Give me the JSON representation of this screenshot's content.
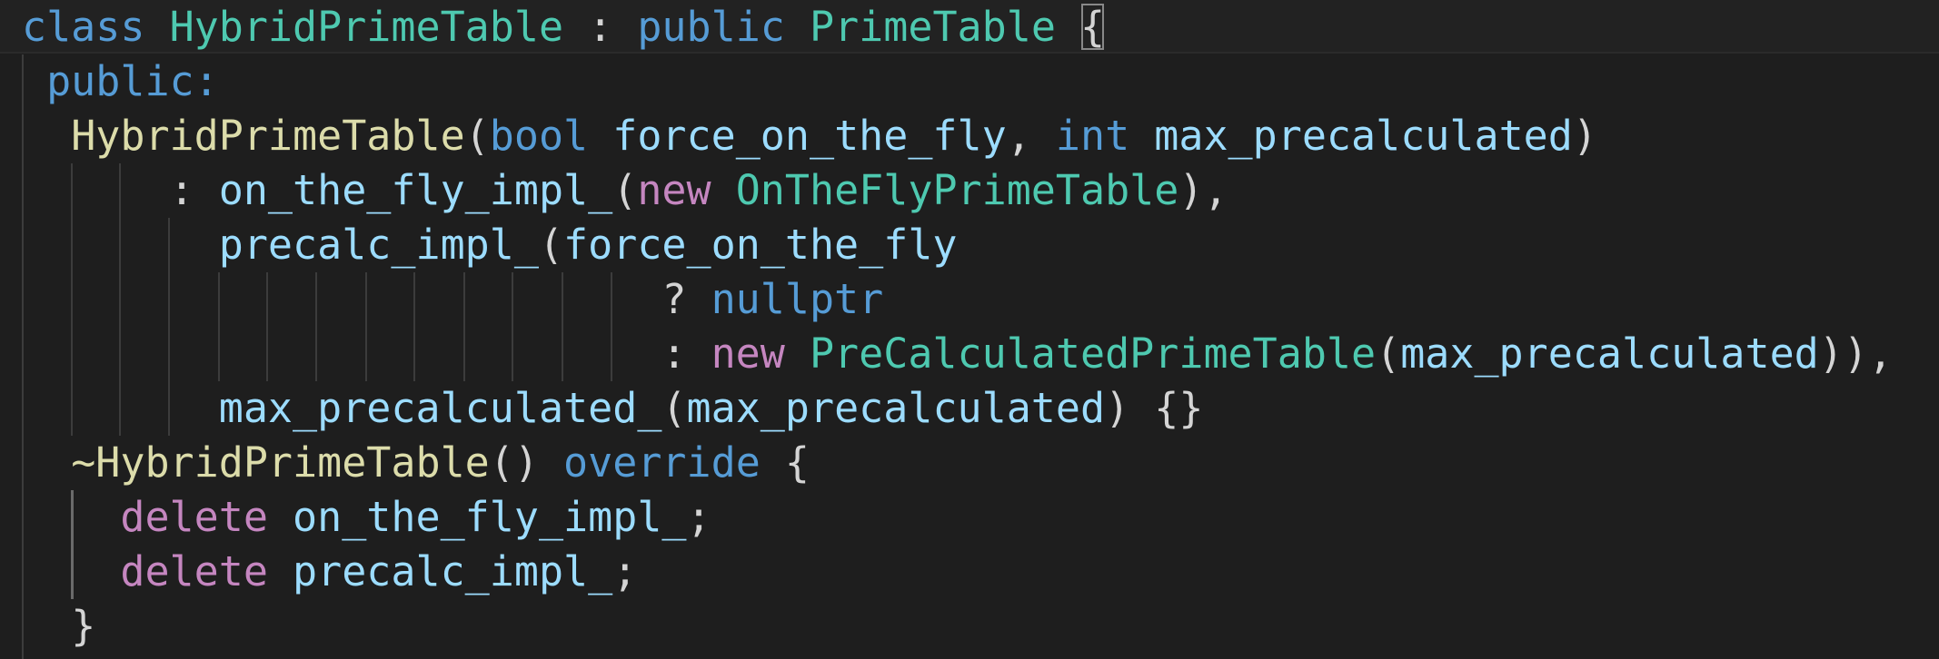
{
  "editor": {
    "language": "cpp",
    "theme_colors": {
      "background": "#1e1e1e",
      "keyword": "#569cd6",
      "type": "#4ec9b0",
      "function": "#dcdcaa",
      "variable": "#9cdcfe",
      "control_keyword": "#c586c0",
      "punctuation": "#d4d4d4"
    },
    "lines": [
      {
        "tokens": [
          {
            "text": "class",
            "kind": "keyword"
          },
          {
            "text": " ",
            "kind": "plain"
          },
          {
            "text": "HybridPrimeTable",
            "kind": "type"
          },
          {
            "text": " : ",
            "kind": "plain"
          },
          {
            "text": "public",
            "kind": "keyword"
          },
          {
            "text": " ",
            "kind": "plain"
          },
          {
            "text": "PrimeTable",
            "kind": "type"
          },
          {
            "text": " ",
            "kind": "plain"
          },
          {
            "text": "{",
            "kind": "plain",
            "matched_bracket": true
          }
        ]
      },
      {
        "tokens": [
          {
            "text": " ",
            "kind": "plain"
          },
          {
            "text": "public:",
            "kind": "keyword"
          }
        ]
      },
      {
        "tokens": [
          {
            "text": "  ",
            "kind": "plain"
          },
          {
            "text": "HybridPrimeTable",
            "kind": "function"
          },
          {
            "text": "(",
            "kind": "plain"
          },
          {
            "text": "bool",
            "kind": "keyword"
          },
          {
            "text": " ",
            "kind": "plain"
          },
          {
            "text": "force_on_the_fly",
            "kind": "variable"
          },
          {
            "text": ", ",
            "kind": "plain"
          },
          {
            "text": "int",
            "kind": "keyword"
          },
          {
            "text": " ",
            "kind": "plain"
          },
          {
            "text": "max_precalculated",
            "kind": "variable"
          },
          {
            "text": ")",
            "kind": "plain"
          }
        ]
      },
      {
        "tokens": [
          {
            "text": "      : ",
            "kind": "plain"
          },
          {
            "text": "on_the_fly_impl_",
            "kind": "variable"
          },
          {
            "text": "(",
            "kind": "plain"
          },
          {
            "text": "new",
            "kind": "control"
          },
          {
            "text": " ",
            "kind": "plain"
          },
          {
            "text": "OnTheFlyPrimeTable",
            "kind": "type"
          },
          {
            "text": "),",
            "kind": "plain"
          }
        ]
      },
      {
        "tokens": [
          {
            "text": "        ",
            "kind": "plain"
          },
          {
            "text": "precalc_impl_",
            "kind": "variable"
          },
          {
            "text": "(",
            "kind": "plain"
          },
          {
            "text": "force_on_the_fly",
            "kind": "variable"
          }
        ]
      },
      {
        "tokens": [
          {
            "text": "                          ? ",
            "kind": "plain"
          },
          {
            "text": "nullptr",
            "kind": "keyword"
          }
        ]
      },
      {
        "tokens": [
          {
            "text": "                          : ",
            "kind": "plain"
          },
          {
            "text": "new",
            "kind": "control"
          },
          {
            "text": " ",
            "kind": "plain"
          },
          {
            "text": "PreCalculatedPrimeTable",
            "kind": "type"
          },
          {
            "text": "(",
            "kind": "plain"
          },
          {
            "text": "max_precalculated",
            "kind": "variable"
          },
          {
            "text": ")),",
            "kind": "plain"
          }
        ]
      },
      {
        "tokens": [
          {
            "text": "        ",
            "kind": "plain"
          },
          {
            "text": "max_precalculated_",
            "kind": "variable"
          },
          {
            "text": "(",
            "kind": "plain"
          },
          {
            "text": "max_precalculated",
            "kind": "variable"
          },
          {
            "text": ") {}",
            "kind": "plain"
          }
        ]
      },
      {
        "tokens": [
          {
            "text": "  ",
            "kind": "plain"
          },
          {
            "text": "~HybridPrimeTable",
            "kind": "function"
          },
          {
            "text": "() ",
            "kind": "plain"
          },
          {
            "text": "override",
            "kind": "keyword"
          },
          {
            "text": " {",
            "kind": "plain"
          }
        ]
      },
      {
        "tokens": [
          {
            "text": "    ",
            "kind": "plain"
          },
          {
            "text": "delete",
            "kind": "control"
          },
          {
            "text": " ",
            "kind": "plain"
          },
          {
            "text": "on_the_fly_impl_",
            "kind": "variable"
          },
          {
            "text": ";",
            "kind": "plain"
          }
        ]
      },
      {
        "tokens": [
          {
            "text": "    ",
            "kind": "plain"
          },
          {
            "text": "delete",
            "kind": "control"
          },
          {
            "text": " ",
            "kind": "plain"
          },
          {
            "text": "precalc_impl_",
            "kind": "variable"
          },
          {
            "text": ";",
            "kind": "plain"
          }
        ]
      },
      {
        "tokens": [
          {
            "text": "  ",
            "kind": "plain"
          },
          {
            "text": "}",
            "kind": "plain"
          }
        ]
      }
    ]
  }
}
